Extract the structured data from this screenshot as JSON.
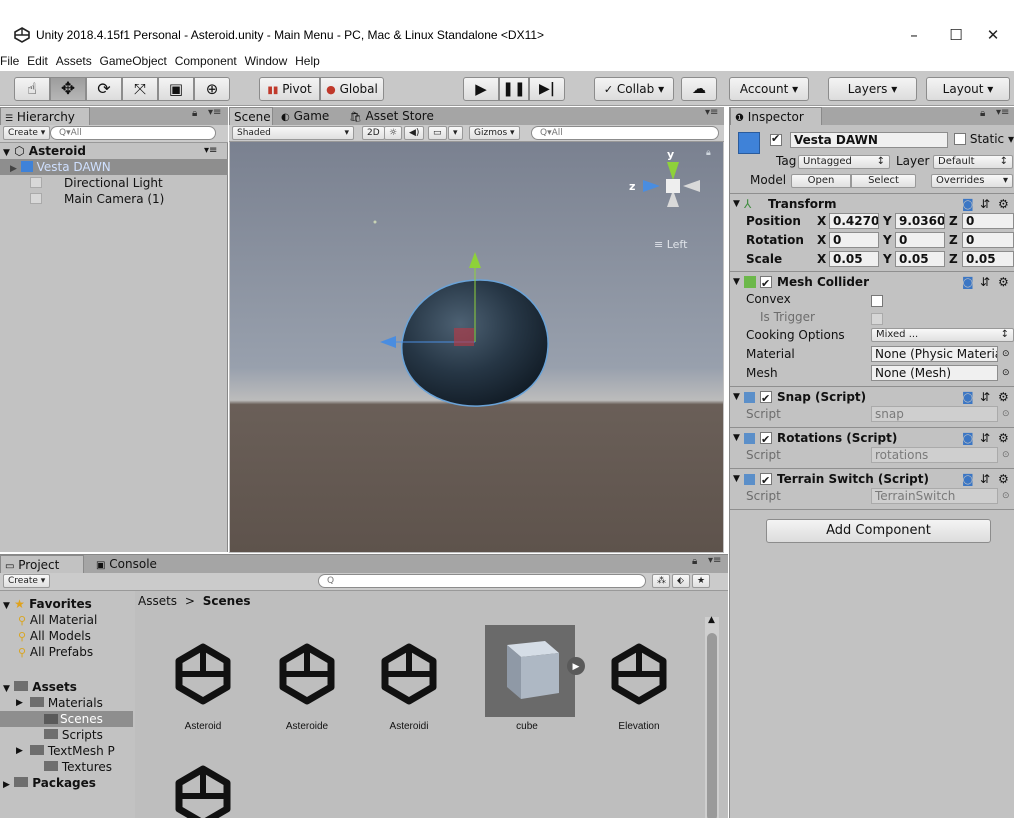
{
  "window": {
    "title": "Unity 2018.4.15f1 Personal - Asteroid.unity - Main Menu - PC, Mac & Linux Standalone <DX11>",
    "minimize": "–",
    "maximize": "☐",
    "close": "✕"
  },
  "menu": [
    "File",
    "Edit",
    "Assets",
    "GameObject",
    "Component",
    "Window",
    "Help"
  ],
  "toolbar": {
    "pivot": "Pivot",
    "global": "Global",
    "collab": "Collab ▾",
    "account": "Account ▾",
    "layers": "Layers ▾",
    "layout": "Layout ▾"
  },
  "hierarchy": {
    "tab": "Hierarchy",
    "create": "Create ▾",
    "search_placeholder": "Q▾All",
    "scene": "Asteroid",
    "items": [
      "Vesta DAWN",
      "Directional Light",
      "Main Camera (1)"
    ]
  },
  "scene_panel": {
    "tabs": [
      "Scene",
      "Game",
      "Asset Store"
    ],
    "shading": "Shaded",
    "mode_2d": "2D",
    "gizmos": "Gizmos ▾",
    "search_placeholder": "Q▾All",
    "gizmo_axis_y": "y",
    "gizmo_axis_z": "z",
    "view_label": "≡ Left"
  },
  "inspector": {
    "tab": "Inspector",
    "object_name": "Vesta DAWN",
    "static_label": "Static ▾",
    "tag_label": "Tag",
    "tag_value": "Untagged",
    "layer_label": "Layer",
    "layer_value": "Default",
    "model_label": "Model",
    "open": "Open",
    "select": "Select",
    "overrides": "Overrides",
    "transform": {
      "title": "Transform",
      "position_label": "Position",
      "rotation_label": "Rotation",
      "scale_label": "Scale",
      "position": {
        "x": "0.4270",
        "y": "9.0360",
        "z": "0"
      },
      "rotation": {
        "x": "0",
        "y": "0",
        "z": "0"
      },
      "scale": {
        "x": "0.05",
        "y": "0.05",
        "z": "0.05"
      }
    },
    "mesh_collider": {
      "title": "Mesh Collider",
      "convex": "Convex",
      "is_trigger": "Is Trigger",
      "cooking_options": "Cooking Options",
      "cooking_value": "Mixed ...",
      "material": "Material",
      "material_value": "None (Physic Materia",
      "mesh": "Mesh",
      "mesh_value": "None (Mesh)"
    },
    "scripts": [
      {
        "title": "Snap (Script)",
        "script_label": "Script",
        "script_value": "snap"
      },
      {
        "title": "Rotations (Script)",
        "script_label": "Script",
        "script_value": "rotations"
      },
      {
        "title": "Terrain Switch (Script)",
        "script_label": "Script",
        "script_value": "TerrainSwitch"
      }
    ],
    "add_component": "Add Component"
  },
  "project": {
    "tabs": [
      "Project",
      "Console"
    ],
    "create": "Create ▾",
    "search_placeholder": "Q",
    "breadcrumb_root": "Assets",
    "breadcrumb_sep": ">",
    "breadcrumb_current": "Scenes",
    "favorites_label": "Favorites",
    "favorites": [
      "All Material",
      "All Models",
      "All Prefabs"
    ],
    "assets_label": "Assets",
    "folders": [
      "Materials",
      "Scenes",
      "Scripts",
      "TextMesh P",
      "Textures"
    ],
    "packages_label": "Packages",
    "files": [
      "Asteroid",
      "Asteroide",
      "Asteroidi",
      "cube",
      "Elevation"
    ]
  },
  "colors": {
    "panel_bg": "#c2c2c2",
    "tab_bar": "#a5a5a5",
    "selection": "#8e8e8e",
    "prefab_blue": "#2a64c6",
    "axis_green": "#8ed13a",
    "axis_blue": "#4a8de0"
  }
}
